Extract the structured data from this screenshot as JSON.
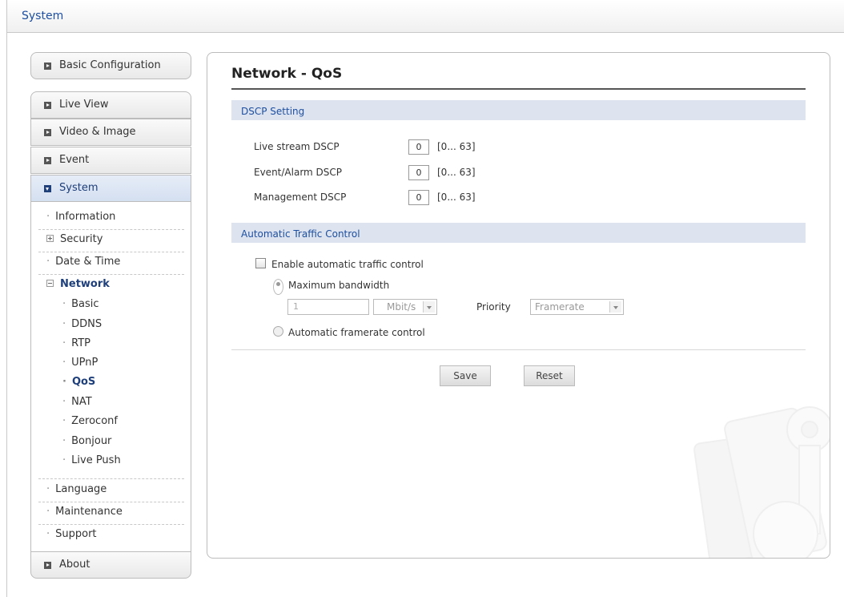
{
  "header": {
    "title": "System"
  },
  "sidebar": {
    "basic_configuration": "Basic Configuration",
    "live_view": "Live View",
    "video_image": "Video & Image",
    "event": "Event",
    "system": "System",
    "about": "About",
    "system_items": {
      "information": "Information",
      "security": "Security",
      "date_time": "Date & Time",
      "network": "Network",
      "language": "Language",
      "maintenance": "Maintenance",
      "support": "Support"
    },
    "network_items": [
      "Basic",
      "DDNS",
      "RTP",
      "UPnP",
      "QoS",
      "NAT",
      "Zeroconf",
      "Bonjour",
      "Live Push"
    ],
    "selected_item": "QoS"
  },
  "main": {
    "title": "Network - QoS",
    "dscp": {
      "header": "DSCP Setting",
      "live_stream_label": "Live stream DSCP",
      "live_stream_value": "0",
      "event_alarm_label": "Event/Alarm DSCP",
      "event_alarm_value": "0",
      "management_label": "Management DSCP",
      "management_value": "0",
      "range": "[0... 63]"
    },
    "traffic": {
      "header": "Automatic Traffic Control",
      "enable_label": "Enable automatic traffic control",
      "enable_checked": false,
      "max_bandwidth_label": "Maximum bandwidth",
      "max_bandwidth_selected": true,
      "bandwidth_value": "1",
      "bandwidth_unit": "Mbit/s",
      "priority_label": "Priority",
      "priority_value": "Framerate",
      "auto_framerate_label": "Automatic framerate control"
    },
    "buttons": {
      "save": "Save",
      "reset": "Reset"
    }
  },
  "colors": {
    "accent": "#1e4fa0",
    "section_header_bg": "#dde4ef",
    "active_nav_bg": "#d4dff0"
  }
}
